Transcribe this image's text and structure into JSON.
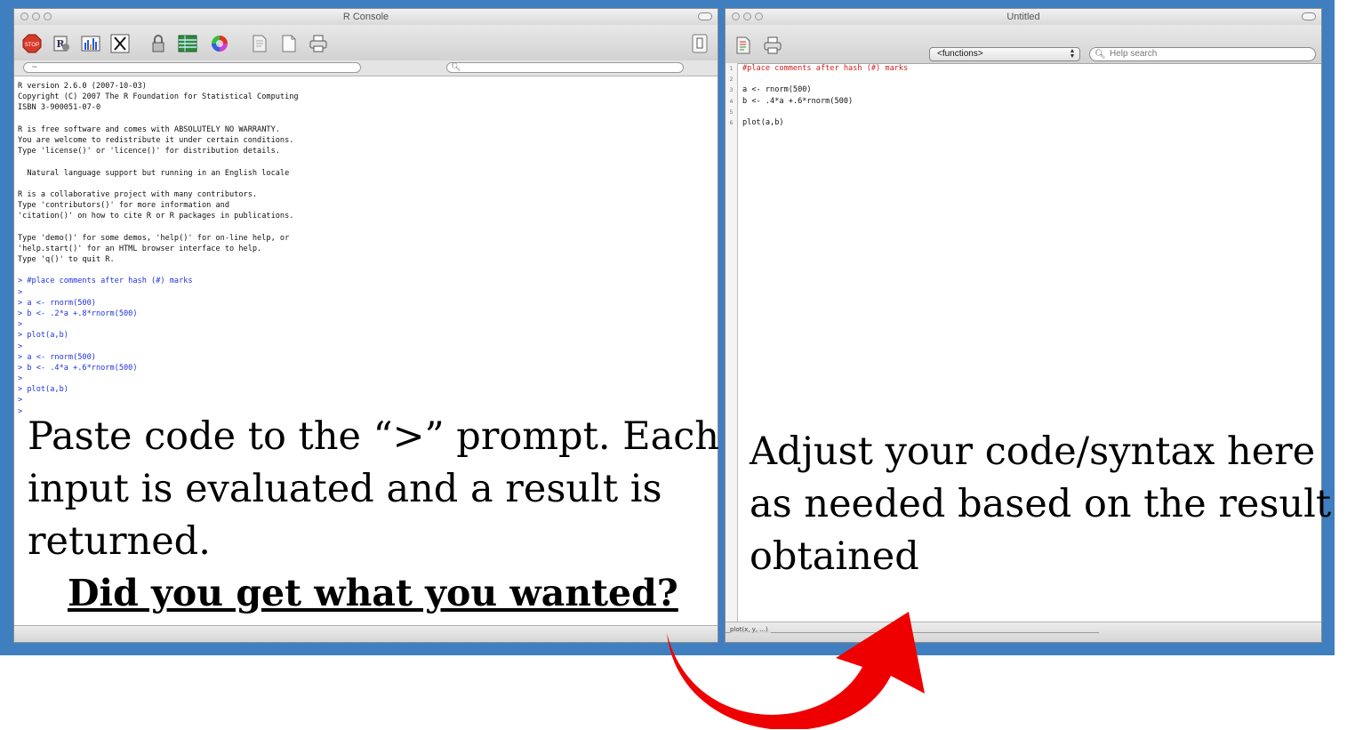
{
  "console": {
    "title": "R Console",
    "filter_placeholder": "~",
    "lines": [
      {
        "text": "R version 2.6.0 (2007-10-03)",
        "kind": "out"
      },
      {
        "text": "Copyright (C) 2007 The R Foundation for Statistical Computing",
        "kind": "out"
      },
      {
        "text": "ISBN 3-900051-07-0",
        "kind": "out"
      },
      {
        "text": "",
        "kind": "out"
      },
      {
        "text": "R is free software and comes with ABSOLUTELY NO WARRANTY.",
        "kind": "out"
      },
      {
        "text": "You are welcome to redistribute it under certain conditions.",
        "kind": "out"
      },
      {
        "text": "Type 'license()' or 'licence()' for distribution details.",
        "kind": "out"
      },
      {
        "text": "",
        "kind": "out"
      },
      {
        "text": "  Natural language support but running in an English locale",
        "kind": "out"
      },
      {
        "text": "",
        "kind": "out"
      },
      {
        "text": "R is a collaborative project with many contributors.",
        "kind": "out"
      },
      {
        "text": "Type 'contributors()' for more information and",
        "kind": "out"
      },
      {
        "text": "'citation()' on how to cite R or R packages in publications.",
        "kind": "out"
      },
      {
        "text": "",
        "kind": "out"
      },
      {
        "text": "Type 'demo()' for some demos, 'help()' for on-line help, or",
        "kind": "out"
      },
      {
        "text": "'help.start()' for an HTML browser interface to help.",
        "kind": "out"
      },
      {
        "text": "Type 'q()' to quit R.",
        "kind": "out"
      },
      {
        "text": "",
        "kind": "out"
      },
      {
        "text": "> #place comments after hash (#) marks",
        "kind": "in"
      },
      {
        "text": ">",
        "kind": "in"
      },
      {
        "text": "> a <- rnorm(500)",
        "kind": "in"
      },
      {
        "text": "> b <- .2*a +.8*rnorm(500)",
        "kind": "in"
      },
      {
        "text": ">",
        "kind": "in"
      },
      {
        "text": "> plot(a,b)",
        "kind": "in"
      },
      {
        "text": ">",
        "kind": "in"
      },
      {
        "text": "> a <- rnorm(500)",
        "kind": "in"
      },
      {
        "text": "> b <- .4*a +.6*rnorm(500)",
        "kind": "in"
      },
      {
        "text": ">",
        "kind": "in"
      },
      {
        "text": "> plot(a,b)",
        "kind": "in"
      },
      {
        "text": ">",
        "kind": "in"
      },
      {
        "text": ">",
        "kind": "in"
      }
    ]
  },
  "editor": {
    "title": "Untitled",
    "functions_select": "<functions>",
    "search_placeholder": "Help search",
    "line_numbers": [
      "1",
      "2",
      "3",
      "4",
      "5",
      "6"
    ],
    "lines": [
      {
        "text": "#place comments after hash (#) marks",
        "kind": "comment"
      },
      {
        "text": "",
        "kind": "code"
      },
      {
        "text": "a <- rnorm(500)",
        "kind": "code"
      },
      {
        "text": "b <- .4*a +.6*rnorm(500)",
        "kind": "code"
      },
      {
        "text": "",
        "kind": "code"
      },
      {
        "text": "plot(a,b)",
        "kind": "code"
      }
    ],
    "status_hint": "plot(x, y, ...)"
  },
  "captions": {
    "left_lines": [
      "Paste code to the “>” prompt.  Each",
      "input is evaluated and a result is",
      "returned."
    ],
    "left_question": "Did you get what you wanted?",
    "right_lines": [
      "Adjust your code/syntax here",
      "as needed based on the result",
      "obtained"
    ]
  },
  "colors": {
    "backdrop": "#3f7fbf",
    "console_input": "#2233dd",
    "editor_comment": "#d02020",
    "arrow": "#ee0000"
  }
}
